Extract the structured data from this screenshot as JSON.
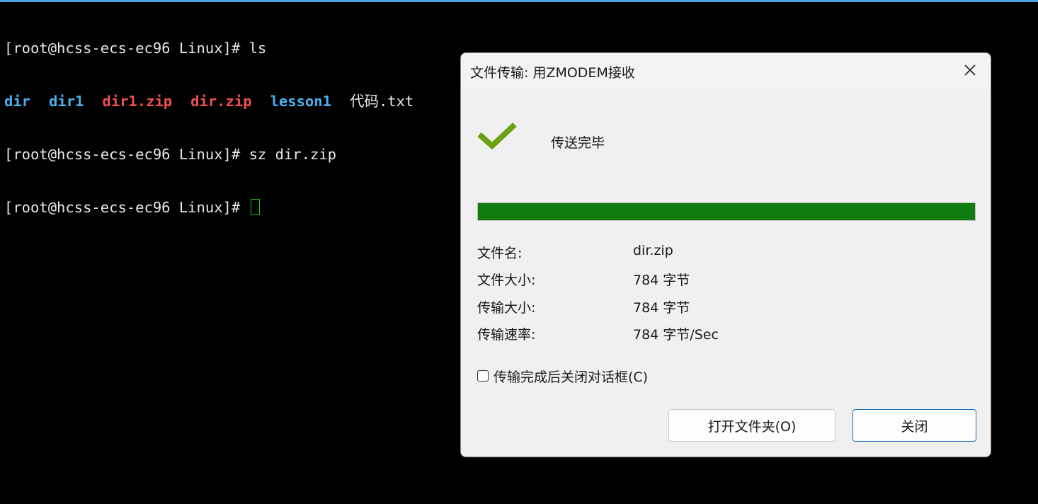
{
  "terminal": {
    "lines": [
      {
        "prompt": "[root@hcss-ecs-ec96 Linux]# ",
        "command": "ls"
      },
      {
        "prompt": "[root@hcss-ecs-ec96 Linux]# ",
        "command": "sz dir.zip"
      },
      {
        "prompt": "[root@hcss-ecs-ec96 Linux]# ",
        "command": ""
      }
    ],
    "ls_output": [
      {
        "name": "dir",
        "kind": "directory"
      },
      {
        "name": "dir1",
        "kind": "directory"
      },
      {
        "name": "dir1.zip",
        "kind": "archive"
      },
      {
        "name": "dir.zip",
        "kind": "archive"
      },
      {
        "name": "lesson1",
        "kind": "directory"
      },
      {
        "name": "代码.txt",
        "kind": "file"
      }
    ]
  },
  "dialog": {
    "title": "文件传输: 用ZMODEM接收",
    "close_icon": "close-icon",
    "status_icon": "checkmark-icon",
    "status": "传送完毕",
    "progress_percent": 100,
    "info": [
      {
        "label": "文件名:",
        "value": "dir.zip"
      },
      {
        "label": "文件大小:",
        "value": "784 字节"
      },
      {
        "label": "传输大小:",
        "value": "784 字节"
      },
      {
        "label": "传输速率:",
        "value": "784 字节/Sec"
      }
    ],
    "close_on_complete_label": "传输完成后关闭对话框(C)",
    "close_on_complete_checked": false,
    "open_folder_button": "打开文件夹(O)",
    "close_button": "关闭"
  },
  "colors": {
    "terminal_bg": "#000000",
    "directory": "#4ab0f0",
    "archive": "#f05050",
    "cursor": "#1ec51e",
    "progress": "#107c10",
    "checkmark": "#6aa012"
  }
}
